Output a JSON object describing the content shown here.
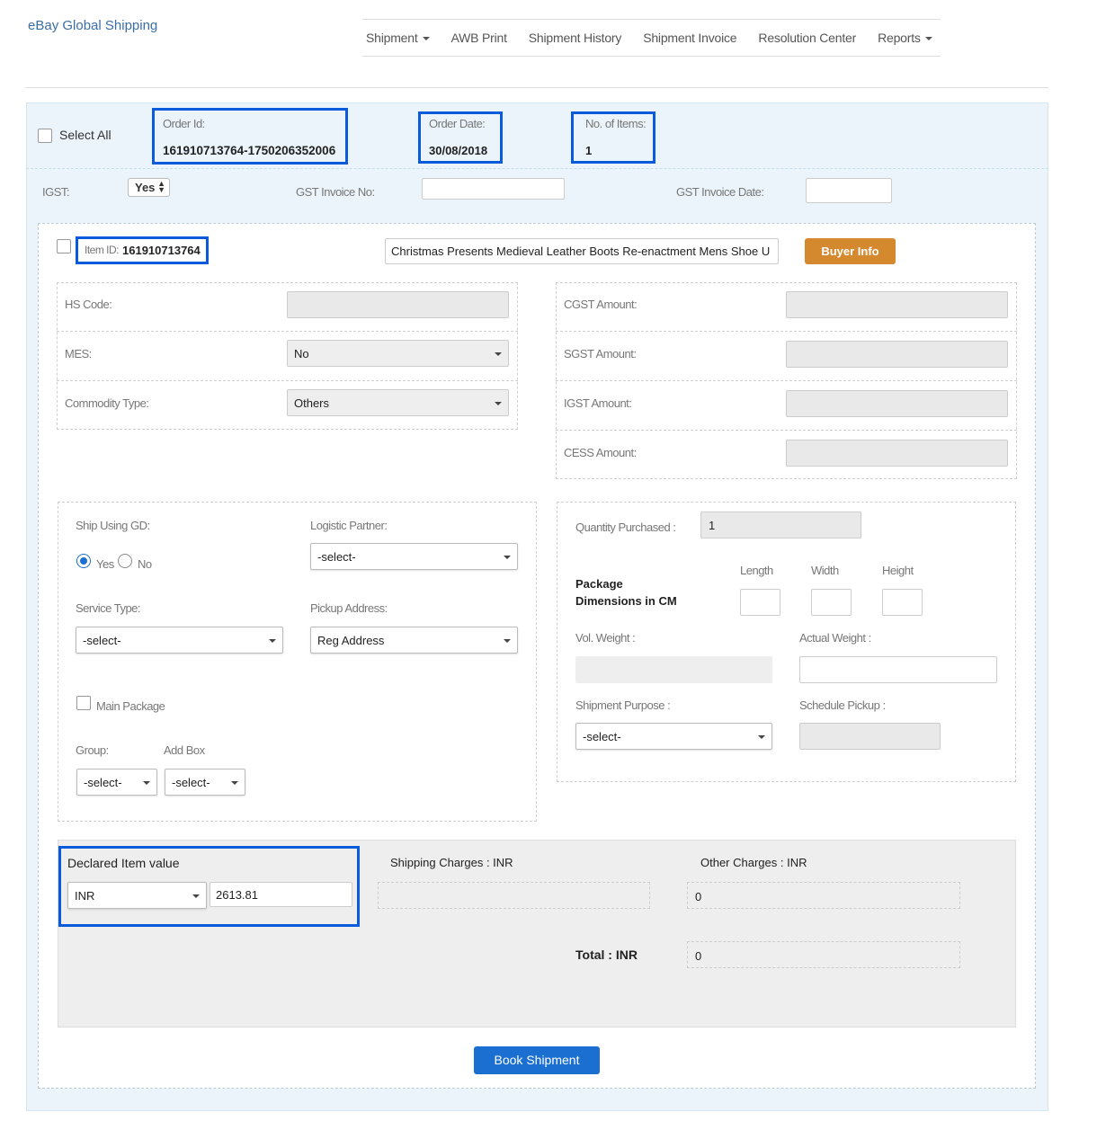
{
  "brand": "eBay Global Shipping",
  "nav": {
    "shipment": "Shipment",
    "awb_print": "AWB Print",
    "shipment_history": "Shipment History",
    "shipment_invoice": "Shipment Invoice",
    "resolution_center": "Resolution Center",
    "reports": "Reports"
  },
  "order": {
    "select_all": "Select All",
    "order_id_label": "Order Id:",
    "order_id": "161910713764-1750206352006",
    "order_date_label": "Order Date:",
    "order_date": "30/08/2018",
    "items_label": "No. of Items:",
    "items": "1"
  },
  "gst": {
    "igst_label": "IGST:",
    "igst_value": "Yes",
    "invoice_no_label": "GST Invoice No:",
    "invoice_date_label": "GST Invoice Date:"
  },
  "item": {
    "item_id_label": "Item ID:",
    "item_id": "161910713764",
    "title": "Christmas Presents Medieval Leather Boots Re-enactment Mens Shoe  U",
    "buyer_info": "Buyer Info"
  },
  "tax_left": {
    "hs_code_label": "HS Code:",
    "mes_label": "MES:",
    "mes_value": "No",
    "commodity_label": "Commodity Type:",
    "commodity_value": "Others"
  },
  "tax_right": {
    "cgst_label": "CGST Amount:",
    "sgst_label": "SGST Amount:",
    "igst_label": "IGST Amount:",
    "cess_label": "CESS Amount:"
  },
  "ship": {
    "ship_using_label": "Ship Using GD:",
    "yes": "Yes",
    "no": "No",
    "logistic_label": "Logistic Partner:",
    "logistic_value": "-select-",
    "service_label": "Service Type:",
    "service_value": "-select-",
    "pickup_label": "Pickup Address:",
    "pickup_value": "Reg Address",
    "main_package": "Main Package",
    "group_label": "Group:",
    "group_value": "-select-",
    "addbox_label": "Add Box",
    "addbox_value": "-select-"
  },
  "package": {
    "qty_label": "Quantity Purchased :",
    "qty_value": "1",
    "dims_label": "Package Dimensions in CM",
    "length": "Length",
    "width": "Width",
    "height": "Height",
    "vol_weight_label": "Vol. Weight :",
    "actual_weight_label": "Actual Weight :",
    "purpose_label": "Shipment Purpose :",
    "purpose_value": "-select-",
    "schedule_label": "Schedule Pickup :"
  },
  "charges": {
    "declared_label": "Declared Item value",
    "currency": "INR",
    "declared_value": "2613.81",
    "shipping_label": "Shipping Charges : INR",
    "other_label": "Other Charges : INR",
    "other_value": "0",
    "total_label": "Total : INR",
    "total_value": "0"
  },
  "book_button": "Book Shipment",
  "colors": {
    "highlight": "#0a5bdc",
    "buyer_button": "#d5892f",
    "book_button": "#1a6fd1",
    "brand_link": "#3a6ea5"
  }
}
